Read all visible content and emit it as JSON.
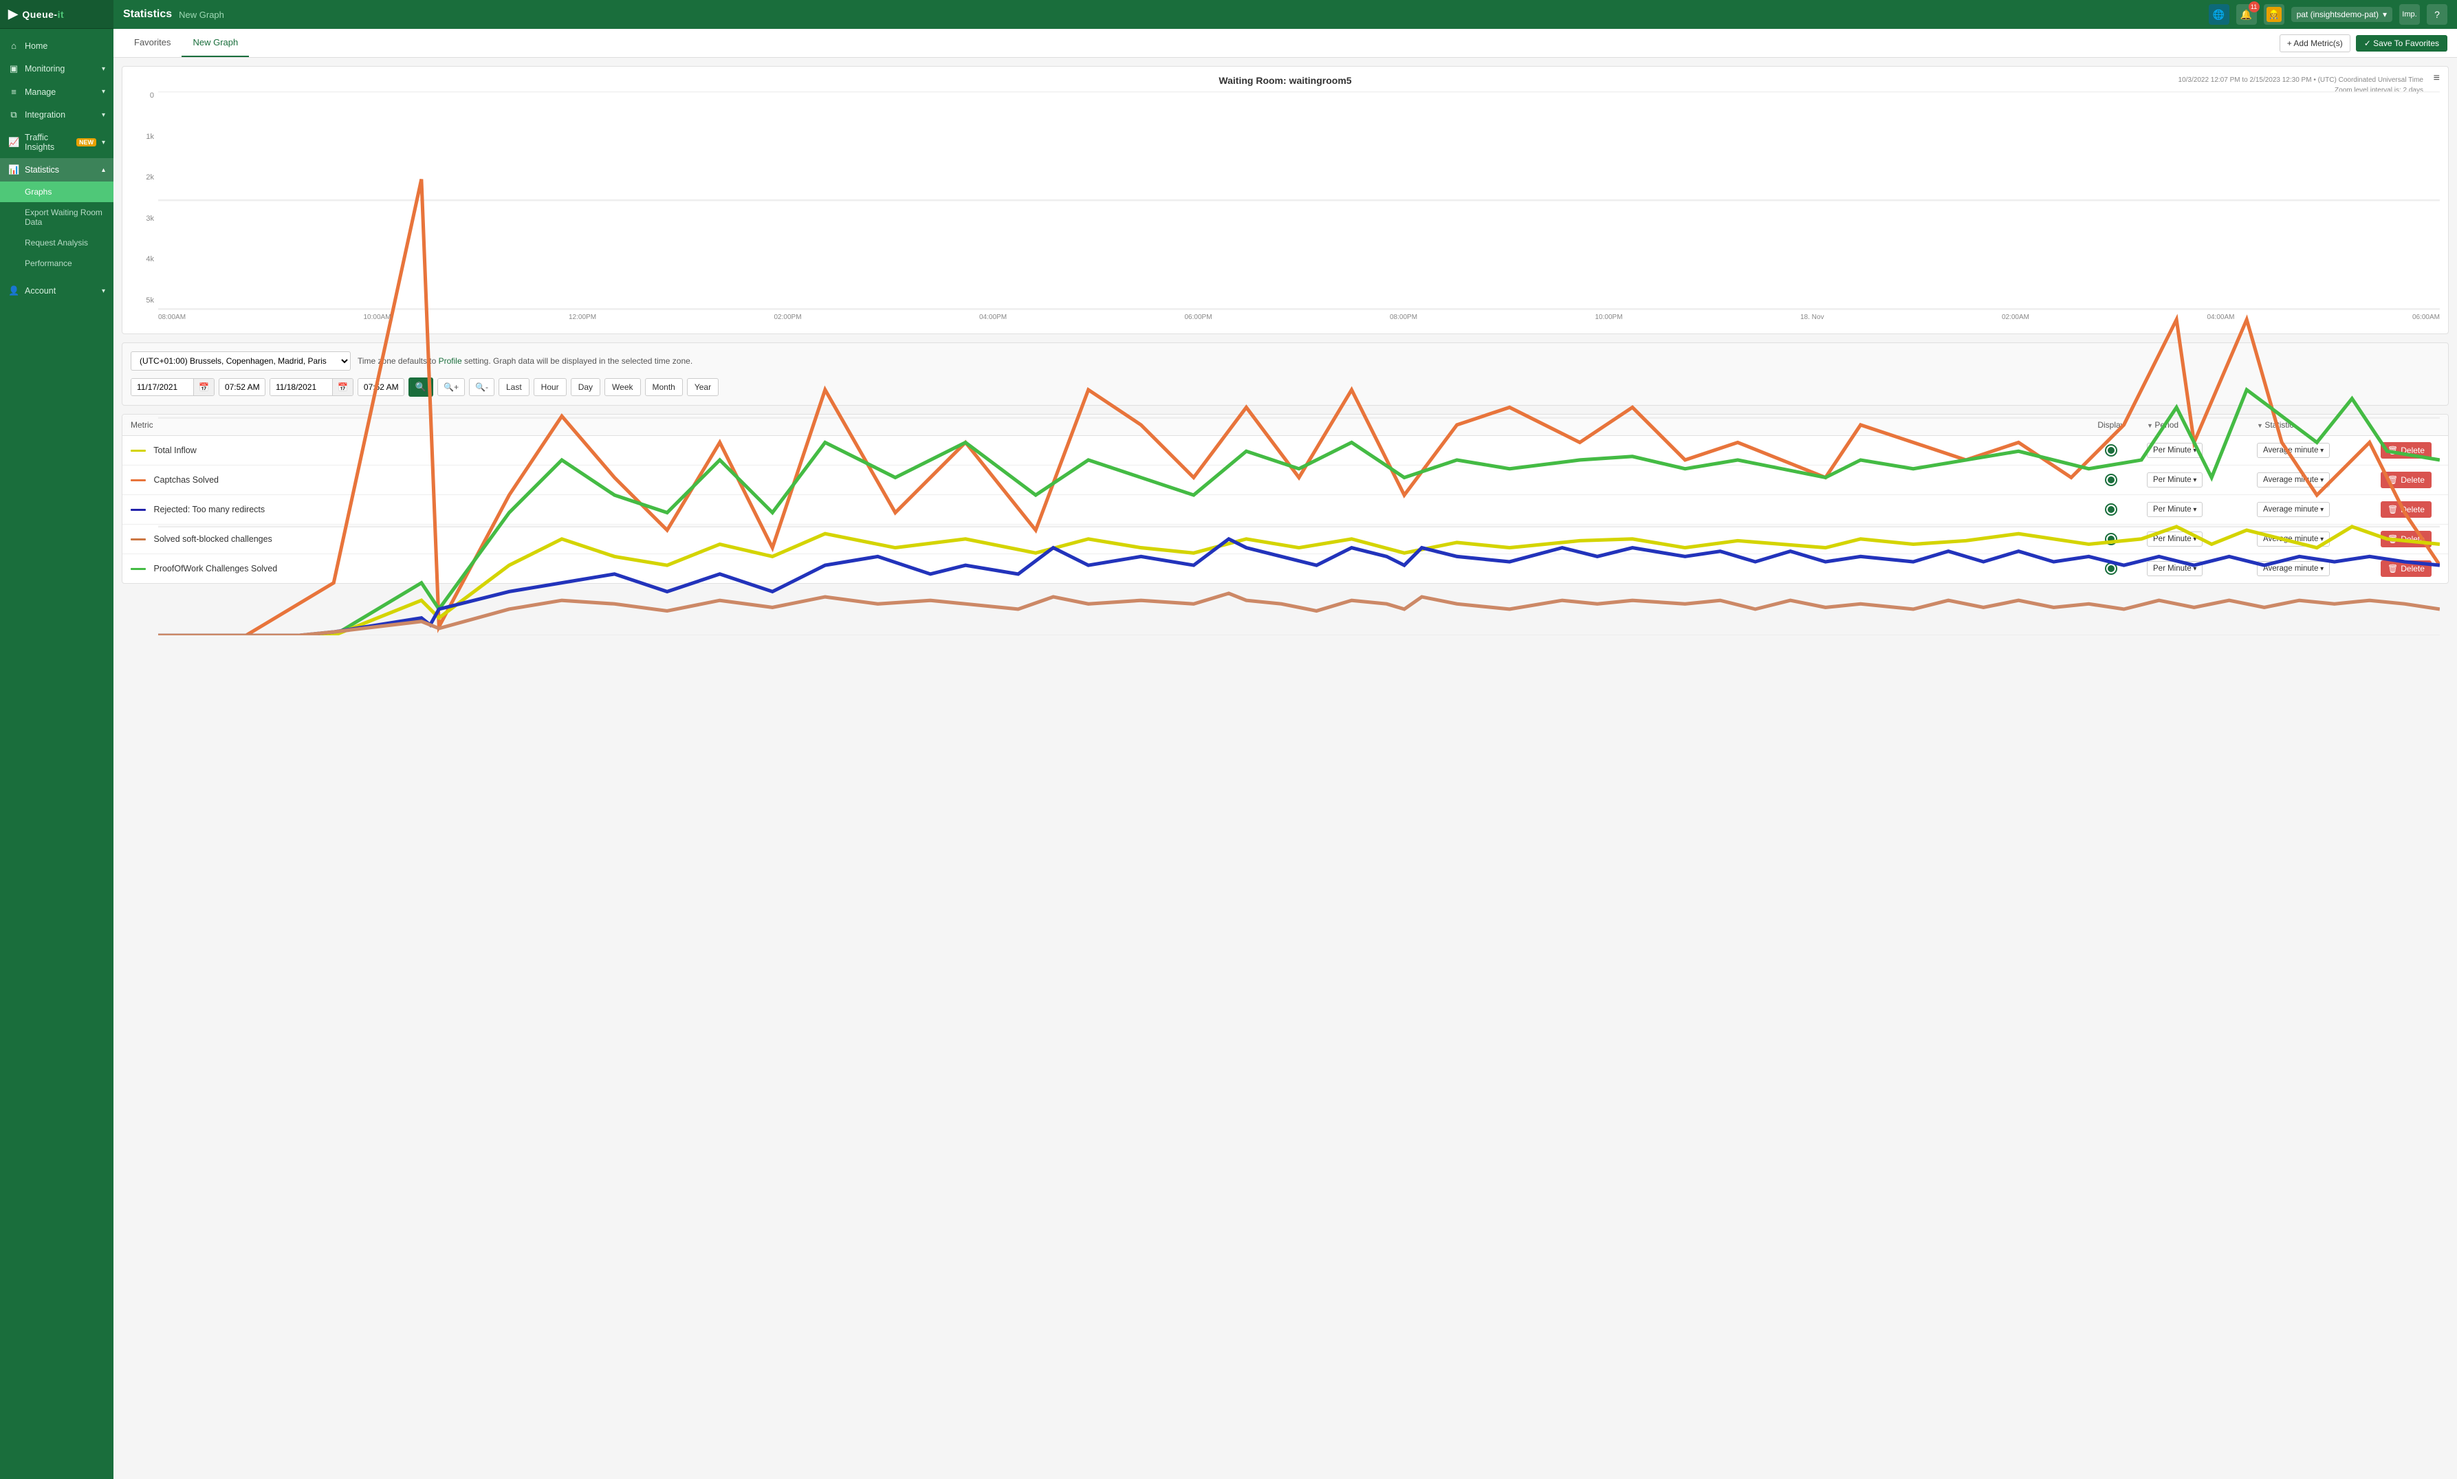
{
  "app": {
    "logo": "Queue-it",
    "logo_dot": "-it"
  },
  "sidebar": {
    "collapse_label": "◀",
    "items": [
      {
        "id": "home",
        "label": "Home",
        "icon": "🏠",
        "active": false,
        "expandable": false
      },
      {
        "id": "monitoring",
        "label": "Monitoring",
        "icon": "📺",
        "active": false,
        "expandable": true
      },
      {
        "id": "manage",
        "label": "Manage",
        "icon": "☰",
        "active": false,
        "expandable": true
      },
      {
        "id": "integration",
        "label": "Integration",
        "icon": "🔗",
        "active": false,
        "expandable": true
      },
      {
        "id": "traffic",
        "label": "Traffic Insights",
        "icon": "📈",
        "active": false,
        "expandable": true,
        "badge": "NEW"
      },
      {
        "id": "statistics",
        "label": "Statistics",
        "icon": "📊",
        "active": true,
        "expandable": true
      }
    ],
    "statistics_sub": [
      {
        "id": "graphs",
        "label": "Graphs",
        "active": true
      },
      {
        "id": "export",
        "label": "Export Waiting Room Data",
        "active": false
      },
      {
        "id": "analysis",
        "label": "Request Analysis",
        "active": false
      },
      {
        "id": "performance",
        "label": "Performance",
        "active": false
      }
    ],
    "bottom_items": [
      {
        "id": "account",
        "label": "Account",
        "icon": "👤",
        "active": false,
        "expandable": true
      }
    ]
  },
  "topbar": {
    "title": "Statistics",
    "subtitle": "New Graph",
    "user_label": "pat (insightsdemo-pat)",
    "user_icon": "👷",
    "notifications": "11",
    "imp_label": "Imp.",
    "help_icon": "?"
  },
  "tabs": [
    {
      "id": "favorites",
      "label": "Favorites",
      "active": false
    },
    {
      "id": "new-graph",
      "label": "New Graph",
      "active": true
    }
  ],
  "toolbar": {
    "add_metric_label": "+ Add Metric(s)",
    "save_label": "✓ Save To Favorites"
  },
  "chart": {
    "title": "Waiting Room: ",
    "room_name": "waitingroom5",
    "date_range": "10/3/2022 12:07 PM to 2/15/2023 12:30 PM • (UTC) Coordinated Universal Time",
    "zoom_info": "Zoom level interval is: 2 days",
    "menu_icon": "≡",
    "y_labels": [
      "5k",
      "4k",
      "3k",
      "2k",
      "1k",
      "0"
    ],
    "x_labels": [
      "08:00AM",
      "10:00AM",
      "12:00PM",
      "02:00PM",
      "04:00PM",
      "06:00PM",
      "08:00PM",
      "10:00PM",
      "18. Nov",
      "02:00AM",
      "04:00AM",
      "06:00AM"
    ]
  },
  "controls": {
    "timezone_value": "(UTC+01:00) Brussels, Copenhagen, Madrid, Paris",
    "timezone_note": "Time zone defaults to Profile setting. Graph data will be displayed in the selected time zone.",
    "profile_link": "Profile",
    "date_from": "11/17/2021",
    "time_from": "07:52 AM",
    "date_to": "11/18/2021",
    "time_to": "07:52 AM",
    "period_buttons": [
      "Last",
      "Hour",
      "Day",
      "Week",
      "Month",
      "Year"
    ]
  },
  "metrics": {
    "columns": {
      "metric": "Metric",
      "display": "Display",
      "period": "Period",
      "statistic": "Statistic"
    },
    "rows": [
      {
        "id": "total-inflow",
        "color": "#d4d400",
        "label": "Total Inflow",
        "display": true,
        "period": "Per Minute",
        "statistic": "Average minute"
      },
      {
        "id": "captchas-solved",
        "color": "#e8743b",
        "label": "Captchas Solved",
        "display": true,
        "period": "Per Minute",
        "statistic": "Average minute"
      },
      {
        "id": "rejected-redirects",
        "color": "#2222aa",
        "label": "Rejected: Too many redirects",
        "display": true,
        "period": "Per Minute",
        "statistic": "Average minute"
      },
      {
        "id": "soft-blocked",
        "color": "#cc7744",
        "label": "Solved soft-blocked challenges",
        "display": true,
        "period": "Per Minute",
        "statistic": "Average minute"
      },
      {
        "id": "proofofwork",
        "color": "#44bb44",
        "label": "ProofOfWork Challenges Solved",
        "display": true,
        "period": "Per Minute",
        "statistic": "Average minute"
      }
    ],
    "delete_label": "Delete"
  }
}
